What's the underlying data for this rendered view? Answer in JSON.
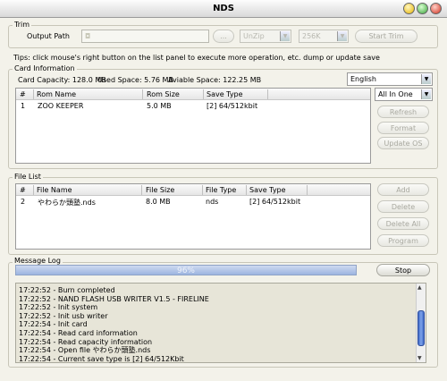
{
  "window": {
    "title": "NDS"
  },
  "trim": {
    "group_label": "Trim",
    "output_path_label": "Output Path",
    "output_path_value": "",
    "browse_label": "...",
    "mode_value": "UnZip",
    "size_value": "256K",
    "start_label": "Start Trim"
  },
  "tips": "Tips: click mouse's right button on the list panel to execute more operation, etc. dump or update save",
  "card": {
    "group_label": "Card Information",
    "capacity": "Card Capacity: 128.0 MB",
    "used": "Used Space: 5.76 MB",
    "available": "Aviable Space: 122.25 MB",
    "language": "English",
    "filter": "All In One",
    "columns": [
      "#",
      "Rom Name",
      "Rom Size",
      "Save Type"
    ],
    "rows": [
      {
        "num": "1",
        "name": "ZOO KEEPER",
        "size": "5.0 MB",
        "save": "[2] 64/512kbit"
      }
    ],
    "buttons": {
      "refresh": "Refresh",
      "format": "Format",
      "update": "Update OS"
    }
  },
  "files": {
    "group_label": "File List",
    "columns": [
      "#",
      "File Name",
      "File Size",
      "File Type",
      "Save Type"
    ],
    "rows": [
      {
        "num": "2",
        "name": "やわらか頭塾.nds",
        "size": "8.0 MB",
        "type": "nds",
        "save": "[2] 64/512kbit"
      }
    ],
    "buttons": {
      "add": "Add",
      "delete": "Delete",
      "delete_all": "Delete All",
      "program": "Program"
    }
  },
  "log": {
    "group_label": "Message Log",
    "progress_text": "96%",
    "progress_value": 0.96,
    "stop_label": "Stop",
    "lines": [
      "17:22:52 - Burn completed",
      "17:22:52 - NAND FLASH USB WRITER V1.5 - FIRELINE",
      "17:22:52 - Init system",
      "17:22:52 - Init usb writer",
      "17:22:54 - Init card",
      "17:22:54 - Read card information",
      "17:22:54 - Read capacity information",
      "17:22:54 - Open file やわらか頭塾.nds",
      "17:22:54 - Current save type is [2] 64/512Kbit"
    ]
  }
}
